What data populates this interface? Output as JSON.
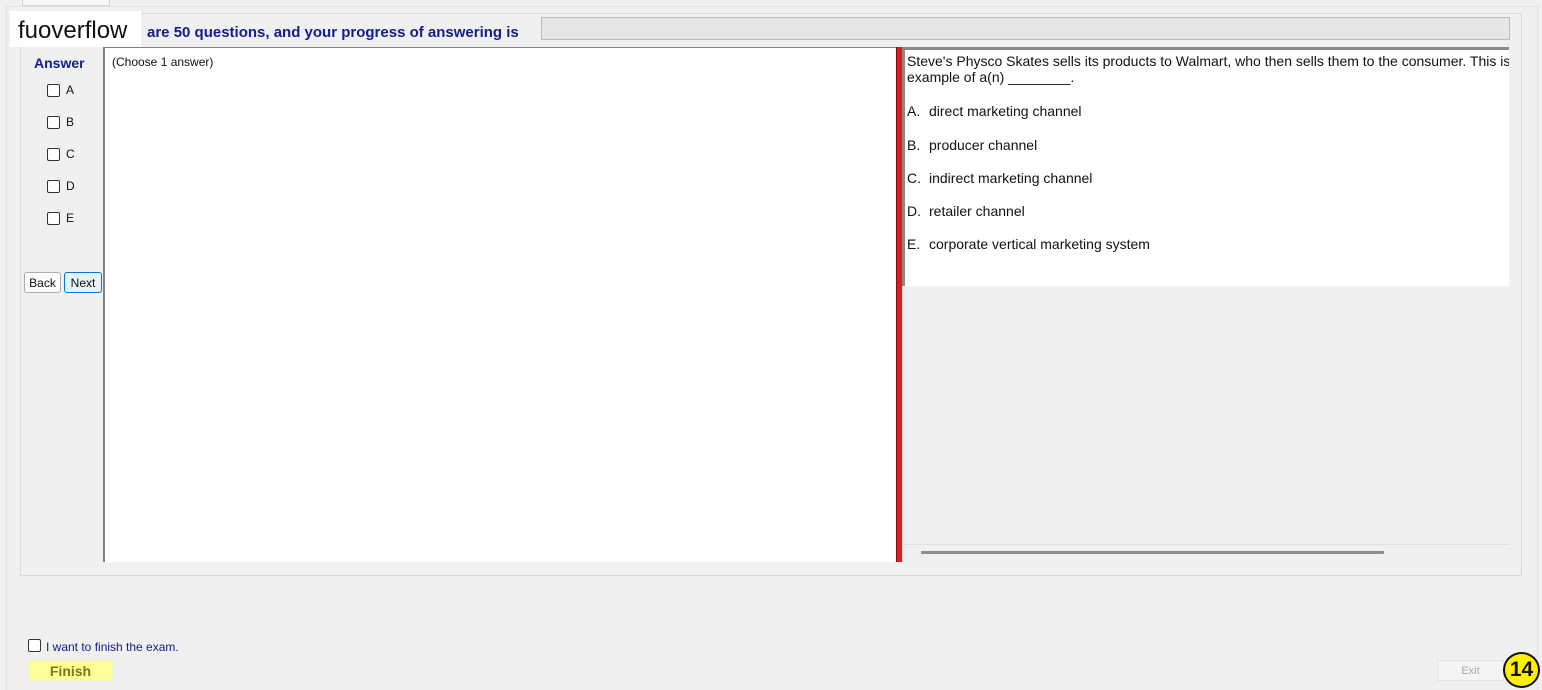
{
  "header": {
    "watermark": "fuoverflow",
    "progress_text": "are 50 questions, and your progress of answering is",
    "progress_fraction": 0.0
  },
  "answer_panel": {
    "title": "Answer",
    "options": [
      "A",
      "B",
      "C",
      "D",
      "E"
    ],
    "back_label": "Back",
    "next_label": "Next",
    "hint": "(Choose 1 answer)"
  },
  "question": {
    "stem": "Steve's Physco Skates sells its products to Walmart, who then sells them to the consumer. This is an example of a(n) ________.",
    "choices": [
      {
        "letter": "A.",
        "text": "direct marketing channel"
      },
      {
        "letter": "B.",
        "text": "producer channel"
      },
      {
        "letter": "C.",
        "text": "indirect marketing channel"
      },
      {
        "letter": "D.",
        "text": "retailer channel"
      },
      {
        "letter": "E.",
        "text": "corporate vertical marketing system"
      }
    ]
  },
  "footer": {
    "finish_check_label": "I want to finish the exam.",
    "finish_label": "Finish",
    "exit_label": "Exit",
    "page_number": "14"
  },
  "colors": {
    "accent_blue": "#13208c",
    "splitter_red": "#e31b1b",
    "finish_yellow": "#ffff99",
    "badge_yellow": "#ffef00"
  }
}
